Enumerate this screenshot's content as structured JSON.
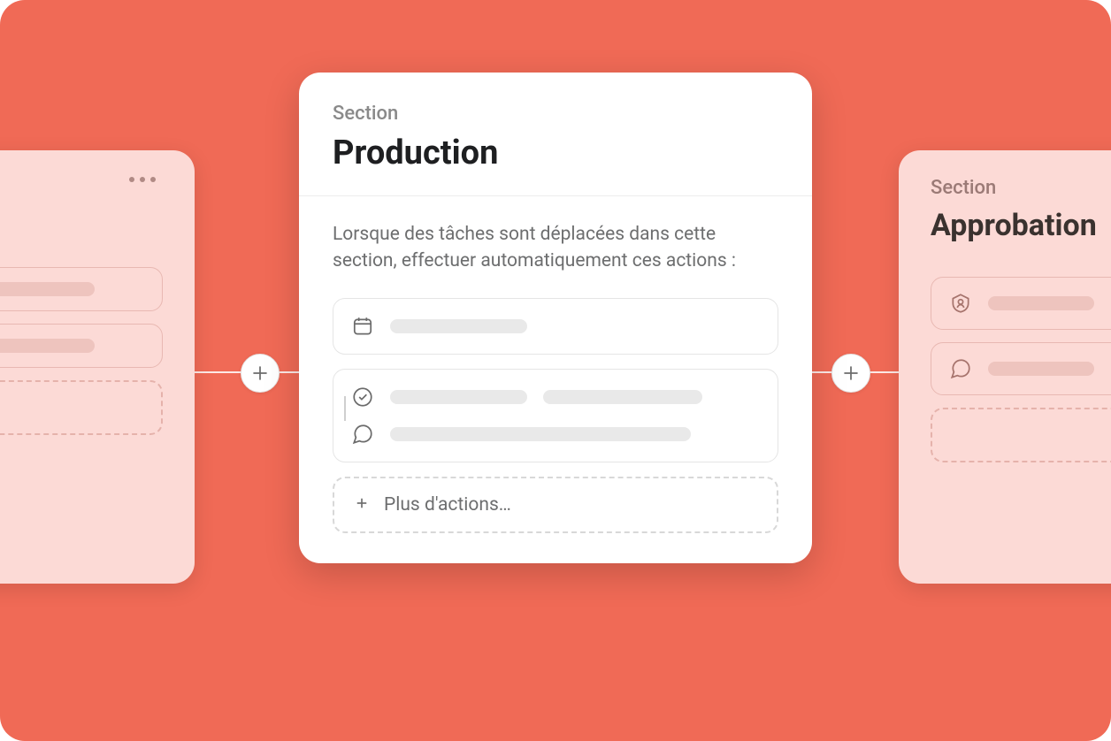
{
  "colors": {
    "canvas_bg": "#F06A56",
    "pink_card": "#FCDAD6",
    "text_muted": "#6D6E6F",
    "text_strong": "#1E1F21"
  },
  "connector": {
    "plus_icon": "plus-icon"
  },
  "left_card": {
    "menu_icon": "ellipsis-icon"
  },
  "main_card": {
    "section_label": "Section",
    "title": "Production",
    "description": "Lorsque des tâches sont déplacées dans cette section, effectuer automatiquement ces actions :",
    "actions": {
      "calendar_icon": "calendar-icon",
      "check_icon": "check-circle-icon",
      "comment_icon": "comment-icon",
      "more_label": "Plus d'actions…",
      "more_plus_icon": "plus-icon"
    }
  },
  "right_card": {
    "section_label": "Section",
    "title": "Approbation",
    "actions": {
      "assignee_icon": "assignee-icon",
      "comment_icon": "comment-icon"
    }
  }
}
